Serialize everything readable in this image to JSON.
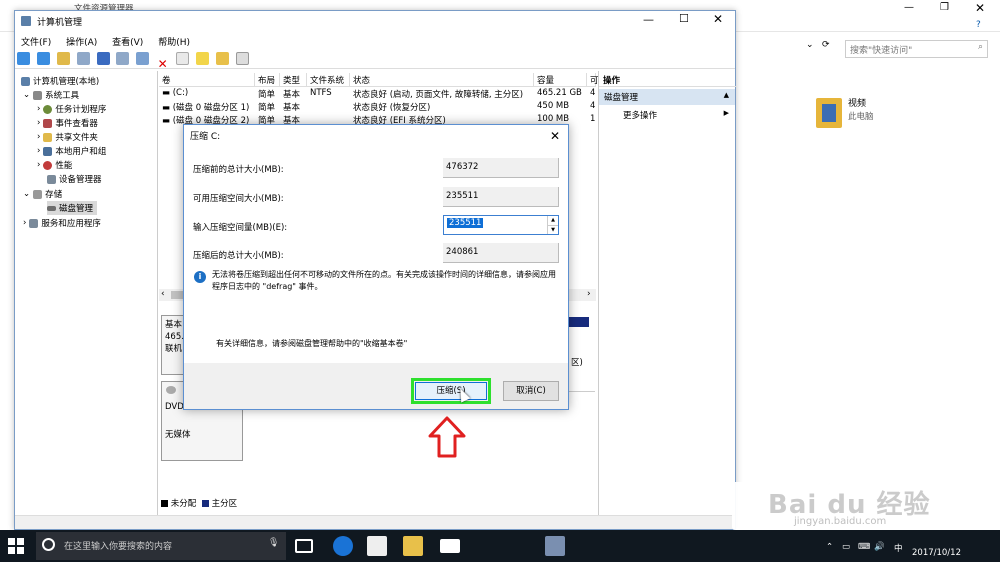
{
  "explorer": {
    "title": "文件资源管理器",
    "search_placeholder": "搜索\"快速访问\"",
    "video_name": "视频",
    "video_location": "此电脑"
  },
  "window": {
    "title": "计算机管理",
    "menu": [
      "文件(F)",
      "操作(A)",
      "查看(V)",
      "帮助(H)"
    ]
  },
  "tree": {
    "root": "计算机管理(本地)",
    "system_tools": "系统工具",
    "task_scheduler": "任务计划程序",
    "event_viewer": "事件查看器",
    "shared_folders": "共享文件夹",
    "local_users": "本地用户和组",
    "performance": "性能",
    "device_manager": "设备管理器",
    "storage": "存储",
    "disk_management": "磁盘管理",
    "services": "服务和应用程序"
  },
  "volumes": {
    "headers": [
      "卷",
      "布局",
      "类型",
      "文件系统",
      "状态",
      "容量",
      "可"
    ],
    "rows": [
      [
        "(C:)",
        "简单",
        "基本",
        "NTFS",
        "状态良好 (启动, 页面文件, 故障转储, 主分区)",
        "465.21 GB",
        "4"
      ],
      [
        "(磁盘 0 磁盘分区 1)",
        "简单",
        "基本",
        "",
        "状态良好 (恢复分区)",
        "450 MB",
        "4"
      ],
      [
        "(磁盘 0 磁盘分区 2)",
        "简单",
        "基本",
        "",
        "状态良好 (EFI 系统分区)",
        "100 MB",
        "1"
      ]
    ]
  },
  "lower": {
    "disk0_line1": "基本",
    "disk0_line2": "465.",
    "disk0_line3": "联机",
    "disk0_tail": "区)",
    "cd_type": "DVD",
    "cd_media": "无媒体",
    "legend_unalloc": "未分配",
    "legend_primary": "主分区"
  },
  "actions": {
    "header": "操作",
    "disk_mgmt": "磁盘管理",
    "more": "更多操作"
  },
  "dialog": {
    "title": "压缩 C:",
    "total_label": "压缩前的总计大小(MB):",
    "total_value": "476372",
    "available_label": "可用压缩空间大小(MB):",
    "available_value": "235511",
    "input_label": "输入压缩空间量(MB)(E):",
    "input_value": "235511",
    "after_label": "压缩后的总计大小(MB):",
    "after_value": "240861",
    "info": "无法将卷压缩到超出任何不可移动的文件所在的点。有关完成该操作时间的详细信息，请参阅应用程序日志中的 \"defrag\" 事件。",
    "help": "有关详细信息，请参阅磁盘管理帮助中的\"收缩基本卷\"",
    "shrink_button": "压缩(S)",
    "cancel_button": "取消(C)"
  },
  "taskbar": {
    "search_placeholder": "在这里输入你要搜索的内容",
    "ime": "中",
    "date": "2017/10/12"
  },
  "watermark": {
    "brand": "Bai du 经验",
    "url": "jingyan.baidu.com"
  },
  "colors": {
    "highlight": "#2ee02e",
    "arrow": "#e02020",
    "selection": "#0f6fd6"
  }
}
